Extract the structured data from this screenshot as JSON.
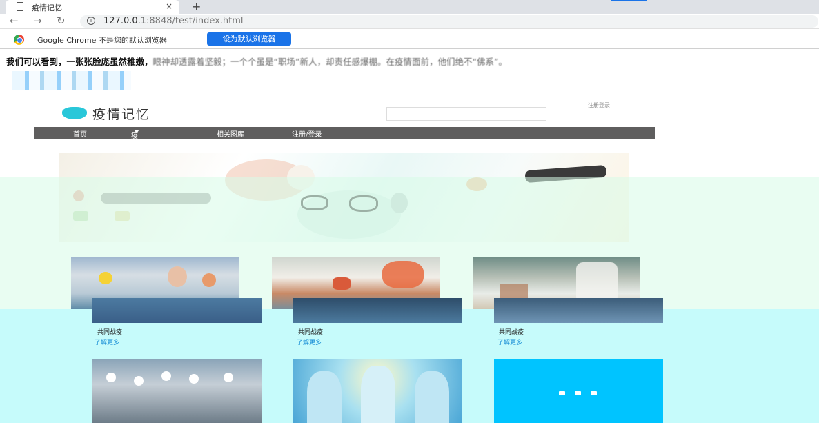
{
  "browser": {
    "tab_title": "疫情记忆",
    "tab_close": "×",
    "new_tab": "+",
    "url_host": "127.0.0.1",
    "url_rest": ":8848/test/index.html",
    "infobar_message": "Google Chrome 不是您的默认浏览器",
    "infobar_button": "设为默认浏览器"
  },
  "quote": {
    "bold": "我们可以看到，一张张脸庞虽然稚嫩，",
    "rest": "眼神却透露着坚毅；一个个虽是“职场”新人，却责任感爆棚。在疫情面前，他们绝不“佛系”。"
  },
  "site": {
    "logo_text": "疫情记忆",
    "top_small": "注册登录",
    "nav": [
      "首页",
      "疫情记忆",
      "相关图库",
      "注册/登录"
    ]
  },
  "cards": [
    {
      "title": "共同战疫",
      "more": "了解更多"
    },
    {
      "title": "共同战疫",
      "more": "了解更多"
    },
    {
      "title": "共同战疫",
      "more": "了解更多"
    }
  ],
  "colors": {
    "accent": "#1a73e8",
    "nav_bg": "#5f5e5e",
    "panel_cyan": "#00c4ff",
    "logo_teal": "#29c7d9"
  }
}
